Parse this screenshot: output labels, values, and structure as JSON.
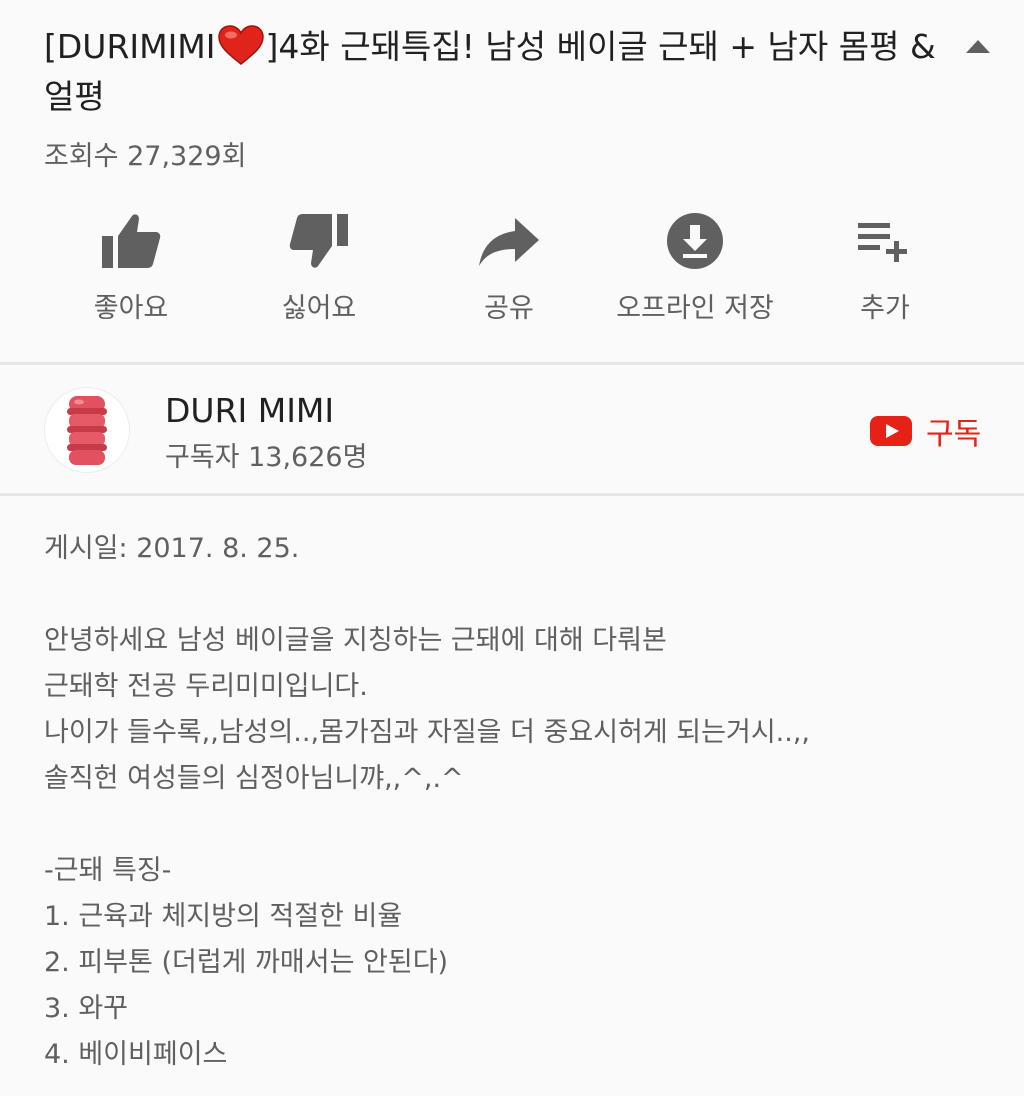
{
  "video": {
    "title_pre": "[DURIMIMI",
    "title_post": "]4화 근돼특집! 남성 베이글 근돼 + 남자 몸평 &얼평",
    "views": "조회수 27,329회"
  },
  "actions": {
    "like": "좋아요",
    "dislike": "싫어요",
    "share": "공유",
    "offline": "오프라인 저장",
    "add": "추가"
  },
  "channel": {
    "name": "DURI MIMI",
    "subscribers": "구독자 13,626명",
    "subscribe_label": "구독"
  },
  "description": {
    "published": "게시일: 2017. 8. 25.",
    "intro": [
      "안녕하세요 남성 베이글을 지칭하는 근돼에 대해 다뤄본",
      "근돼학 전공 두리미미입니다.",
      "나이가 들수록,,남성의..,몸가짐과 자질을 더 중요시허게 되는거시..,,",
      "솔직헌 여성들의 심정아님니꺄,,^,.^"
    ],
    "list_title": "-근돼 특징-",
    "items": [
      "1. 근육과 체지방의 적절한 비율",
      "2. 피부톤 (더럽게 까매서는 안된다)",
      "3. 와꾸",
      "4. 베이비페이스"
    ]
  },
  "colors": {
    "accent_red": "#e62117",
    "icon_gray": "#606060",
    "background": "#fafafa"
  },
  "icons": [
    "heart-emoji-icon",
    "collapse-chevron-icon",
    "thumbs-up-icon",
    "thumbs-down-icon",
    "share-icon",
    "download-icon",
    "add-to-playlist-icon",
    "youtube-logo-icon"
  ]
}
